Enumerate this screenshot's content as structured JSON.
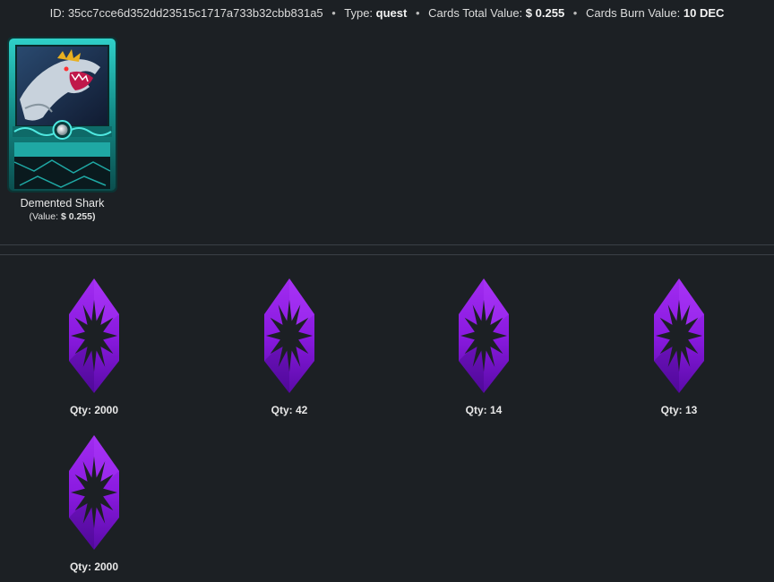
{
  "header": {
    "id_label": "ID:",
    "id_value": "35cc7cce6d352dd23515c1717a733b32cbb831a5",
    "type_label": "Type:",
    "type_value": "quest",
    "total_label": "Cards Total Value:",
    "total_value": "$ 0.255",
    "burn_label": "Cards Burn Value:",
    "burn_value": "10 DEC",
    "separator": "•"
  },
  "card": {
    "name": "Demented Shark",
    "value_label": "(Value:",
    "value_amount": "$ 0.255)"
  },
  "rewards": [
    {
      "icon": "potion-icon",
      "qty_label": "Qty:",
      "qty": "2000"
    },
    {
      "icon": "potion-icon",
      "qty_label": "Qty:",
      "qty": "42"
    },
    {
      "icon": "potion-icon",
      "qty_label": "Qty:",
      "qty": "14"
    },
    {
      "icon": "potion-icon",
      "qty_label": "Qty:",
      "qty": "13"
    },
    {
      "icon": "potion-icon",
      "qty_label": "Qty:",
      "qty": "2000"
    }
  ],
  "colors": {
    "background": "#1c2024",
    "potion_purple": "#8a1ae0",
    "card_teal": "#1fb8b0"
  }
}
